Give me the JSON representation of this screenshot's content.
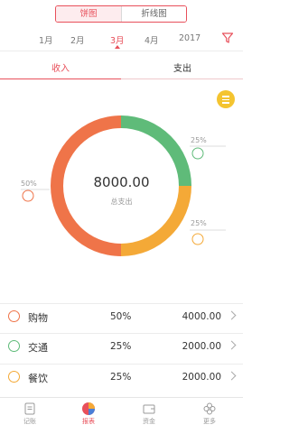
{
  "view_toggle": {
    "options": [
      "饼图",
      "折线图"
    ]
  },
  "months": {
    "items": [
      "1月",
      "2月",
      "3月",
      "4月",
      "2017"
    ]
  },
  "type_tabs": {
    "income_label": "收入",
    "expense_label": "支出"
  },
  "summary": {
    "total_value": "8000.00",
    "total_label": "总支出"
  },
  "chart_data": {
    "type": "pie",
    "slices": [
      {
        "category": "购物",
        "percent": 50,
        "color": "#ef7449"
      },
      {
        "category": "交通",
        "percent": 25,
        "color": "#5fbb79"
      },
      {
        "category": "餐饮",
        "percent": 25,
        "color": "#f4a937"
      }
    ]
  },
  "slice_labels": {
    "shopping": "50%",
    "transport": "25%",
    "dining": "25%"
  },
  "categories": [
    {
      "name": "购物",
      "percent": "50%",
      "amount": "4000.00",
      "color": "#ef7449"
    },
    {
      "name": "交通",
      "percent": "25%",
      "amount": "2000.00",
      "color": "#5fbb79"
    },
    {
      "name": "餐饮",
      "percent": "25%",
      "amount": "2000.00",
      "color": "#f4a937"
    }
  ],
  "tabbar": {
    "items": [
      "记账",
      "报表",
      "资金",
      "更多"
    ],
    "active_color": "#e8505b"
  }
}
